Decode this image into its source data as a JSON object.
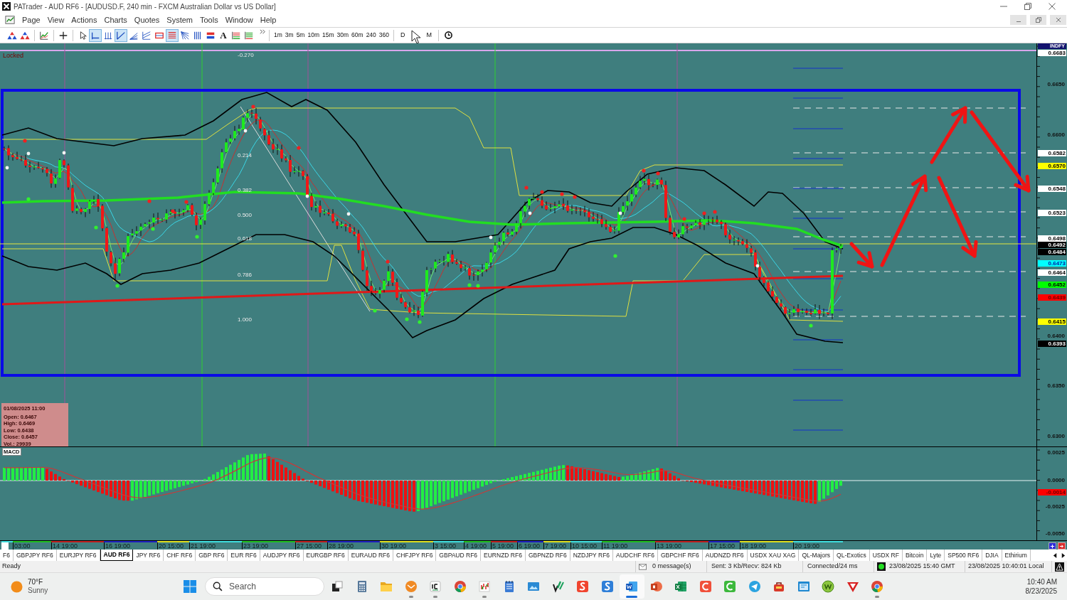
{
  "window": {
    "title": "PATrader - AUD RF6 - [AUDUSD.F, 240 min - FXCM Australian Dollar vs US Dollar]"
  },
  "menu": [
    "Page",
    "View",
    "Actions",
    "Charts",
    "Quotes",
    "System",
    "Tools",
    "Window",
    "Help"
  ],
  "toolbar": {
    "tools": [
      {
        "selected": false
      },
      {
        "selected": false
      },
      {
        "selected": false
      },
      {
        "selected": false
      },
      {
        "selected": false
      },
      {
        "selected": true
      },
      {
        "selected": false
      },
      {
        "selected": true
      },
      {
        "selected": false
      },
      {
        "selected": false
      },
      {
        "selected": false
      },
      {
        "selected": true
      },
      {
        "selected": false
      },
      {
        "selected": false
      },
      {
        "selected": false
      },
      {
        "selected": false,
        "label": "A"
      },
      {
        "selected": false
      },
      {
        "selected": false
      }
    ],
    "timeframes": [
      "1m",
      "3m",
      "5m",
      "10m",
      "15m",
      "30m",
      "60m",
      "240",
      "360"
    ],
    "periods": [
      "D",
      "M"
    ]
  },
  "chart": {
    "status": "Locked",
    "symbol_tag": "INDFY",
    "fib_levels": [
      "-0.270",
      "0.214",
      "0.382",
      "0.500",
      "0.618",
      "0.786",
      "1.000"
    ],
    "price_ticks": [
      "0.6650",
      "0.6600",
      "0.6400",
      "0.6350",
      "0.6300"
    ],
    "price_markers": [
      {
        "label": "0.6683",
        "color": "#ffffff"
      },
      {
        "label": "0.6582",
        "color": "#ffffff"
      },
      {
        "label": "0.6570",
        "color": "#ffff00"
      },
      {
        "label": "0.6548",
        "color": "#ffffff"
      },
      {
        "label": "0.6523",
        "color": "#ffffff"
      },
      {
        "label": "0.6498",
        "color": "#ffffff"
      },
      {
        "label": "0.6492",
        "color": "#000000"
      },
      {
        "label": "0.6484",
        "color": "#000000"
      },
      {
        "label": "0.6473",
        "color": "#00ffff"
      },
      {
        "label": "0.6464",
        "color": "#ffffff"
      },
      {
        "label": "0.6452",
        "color": "#00ff00"
      },
      {
        "label": "0.6439",
        "color": "#ff0000"
      },
      {
        "label": "0.6415",
        "color": "#ffff00"
      },
      {
        "label": "0.6393",
        "color": "#000000"
      }
    ],
    "info_box": {
      "date": "01/08/2025 11:00",
      "lines": [
        "Open: 0.6467",
        "High: 0.6469",
        "Low: 0.6438",
        "Close: 0.6457",
        "Vol.: 29939"
      ]
    }
  },
  "macd": {
    "label": "MACD",
    "ticks": [
      "0.0025",
      "0.0000",
      "-0.0025",
      "-0.0050"
    ],
    "markers": [
      {
        "label": "-0.0014",
        "color": "#ff0000"
      }
    ]
  },
  "time_axis": {
    "labels": [
      "03:00",
      "14 19:00",
      "16 19:00",
      "20 15:00",
      "21 19:00",
      "23 19:00",
      "27 15:00",
      "28 19:00",
      "30 19:00",
      "3 15:00",
      "4 19:00",
      "5 19:00",
      "6 19:00",
      "7 19:00",
      "10 15:00",
      "11 19:00",
      "13 19:00",
      "17 15:00",
      "18 19:00",
      "20 19:00"
    ]
  },
  "tabs": [
    {
      "label": "F6",
      "selected": false
    },
    {
      "label": "GBPJPY RF6",
      "selected": false
    },
    {
      "label": "EURJPY RF6",
      "selected": false
    },
    {
      "label": "AUD RF6",
      "selected": true
    },
    {
      "label": "JPY RF6",
      "selected": false
    },
    {
      "label": "CHF RF6",
      "selected": false
    },
    {
      "label": "GBP RF6",
      "selected": false
    },
    {
      "label": "EUR RF6",
      "selected": false
    },
    {
      "label": "AUDJPY RF6",
      "selected": false
    },
    {
      "label": "EURGBP RF6",
      "selected": false
    },
    {
      "label": "EURAUD RF6",
      "selected": false
    },
    {
      "label": "CHFJPY RF6",
      "selected": false
    },
    {
      "label": "GBPAUD RF6",
      "selected": false
    },
    {
      "label": "EURNZD RF6",
      "selected": false
    },
    {
      "label": "GBPNZD RF6",
      "selected": false
    },
    {
      "label": "NZDJPY RF6",
      "selected": false
    },
    {
      "label": "AUDCHF RF6",
      "selected": false
    },
    {
      "label": "GBPCHF RF6",
      "selected": false
    },
    {
      "label": "AUDNZD RF6",
      "selected": false
    },
    {
      "label": "USDX XAU XAG",
      "selected": false
    },
    {
      "label": "QL-Majors",
      "selected": false
    },
    {
      "label": "QL-Exotics",
      "selected": false
    },
    {
      "label": "USDX RF",
      "selected": false
    },
    {
      "label": "Bitcoin",
      "selected": false
    },
    {
      "label": "Lyte",
      "selected": false
    },
    {
      "label": "SP500 RF6",
      "selected": false
    },
    {
      "label": "DJIA",
      "selected": false
    },
    {
      "label": "Ethirium",
      "selected": false
    }
  ],
  "status_bar": {
    "state": "Ready",
    "messages": "0 message(s)",
    "traffic": "Sent: 3 Kb/Recv: 824 Kb",
    "connection": "Connected/24 ms",
    "server_time": "23/08/2025 15:40 GMT",
    "local_time": "23/08/2025 10:40:01 Local"
  },
  "taskbar": {
    "weather": {
      "temperature": "70°F",
      "condition": "Sunny"
    },
    "search": {
      "placeholder": "Search"
    },
    "apps": [
      {
        "running": false,
        "selected": false
      },
      {
        "running": false,
        "selected": false
      },
      {
        "running": false,
        "selected": false
      },
      {
        "running": true,
        "selected": false
      },
      {
        "running": true,
        "selected": false
      },
      {
        "running": false,
        "selected": false
      },
      {
        "running": true,
        "selected": false
      },
      {
        "running": false,
        "selected": false
      },
      {
        "running": false,
        "selected": false
      },
      {
        "running": false,
        "selected": false
      },
      {
        "running": false,
        "selected": false
      },
      {
        "running": false,
        "selected": false
      },
      {
        "running": true,
        "selected": true
      },
      {
        "running": false,
        "selected": false
      },
      {
        "running": false,
        "selected": false
      },
      {
        "running": false,
        "selected": false
      },
      {
        "running": false,
        "selected": false
      },
      {
        "running": false,
        "selected": false
      },
      {
        "running": false,
        "selected": false
      },
      {
        "running": false,
        "selected": false
      },
      {
        "running": false,
        "selected": false
      },
      {
        "running": false,
        "selected": false
      },
      {
        "running": true,
        "selected": false
      }
    ],
    "clock": {
      "time": "10:40 AM",
      "date": "8/23/2025"
    }
  }
}
